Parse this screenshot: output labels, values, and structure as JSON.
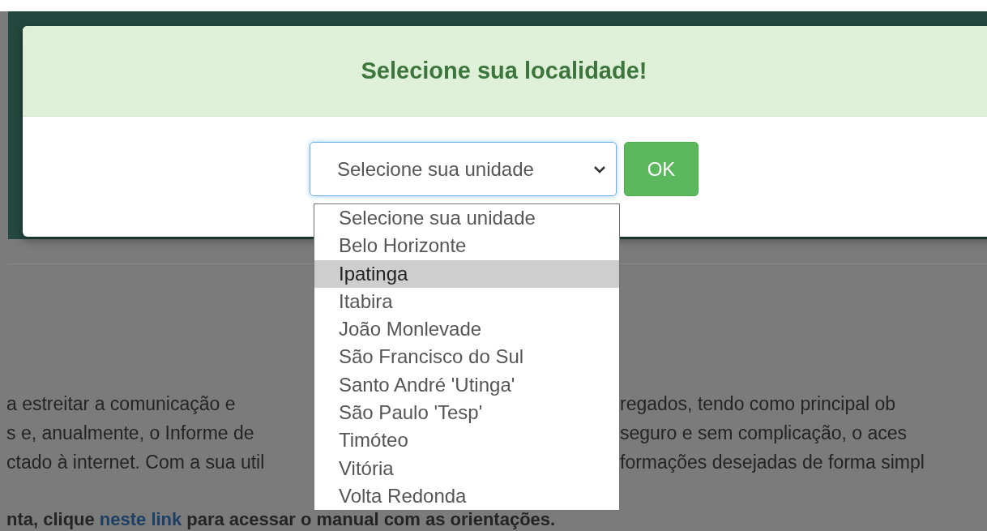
{
  "dialog": {
    "title": "Selecione sua localidade!",
    "select": {
      "value": "Selecione sua unidade",
      "expanded": true
    },
    "ok_button": "OK"
  },
  "dropdown": {
    "options": [
      {
        "label": "Selecione sua unidade",
        "selected": false
      },
      {
        "label": "Belo Horizonte",
        "selected": false
      },
      {
        "label": "Ipatinga",
        "selected": true
      },
      {
        "label": "Itabira",
        "selected": false
      },
      {
        "label": "João Monlevade",
        "selected": false
      },
      {
        "label": "São Francisco do Sul",
        "selected": false
      },
      {
        "label": "Santo André 'Utinga'",
        "selected": false
      },
      {
        "label": "São Paulo 'Tesp'",
        "selected": false
      },
      {
        "label": "Timóteo",
        "selected": false
      },
      {
        "label": "Vitória",
        "selected": false
      },
      {
        "label": "Volta Redonda",
        "selected": false
      }
    ]
  },
  "page_text": {
    "lines": [
      {
        "left": "a estreitar a comunicação e",
        "right": "regados, tendo como principal ob"
      },
      {
        "left": "s e, anualmente, o Informe de",
        "right": "seguro e sem complicação, o aces"
      },
      {
        "left": "ctado à internet. Com a sua util",
        "right": "formações desejadas de forma simpl"
      }
    ],
    "note": {
      "before": "nta, clique",
      "link": "neste link",
      "after": "para acessar o manual com as orientações."
    }
  }
}
